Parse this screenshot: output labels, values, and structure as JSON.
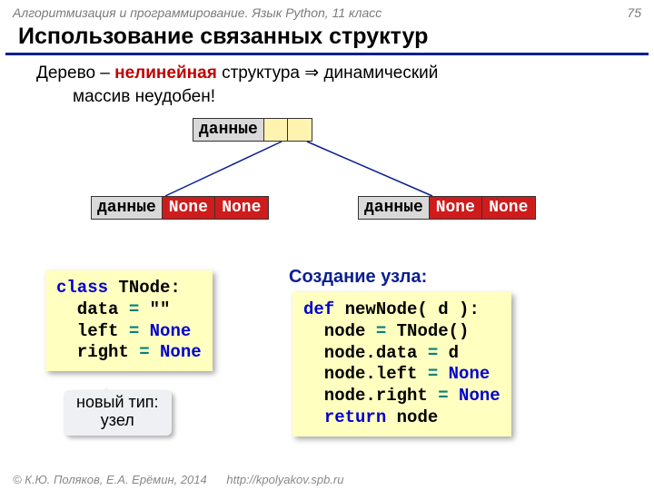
{
  "header": {
    "course": "Алгоритмизация и программирование. Язык Python, 11 класс",
    "page": "75"
  },
  "title": "Использование связанных структур",
  "subtitle": {
    "before": "Дерево – ",
    "nonlinear": "нелинейная",
    "after": " структура ⇒ динамический",
    "line2": "массив неудобен!"
  },
  "node": {
    "data": "данные",
    "none": "None"
  },
  "code_class": {
    "line1_kw": "class",
    "line1_rest": " TNode:",
    "line2a": "  data ",
    "line2op": "=",
    "line2b": " \"\"",
    "line3a": "  left ",
    "line3op": "=",
    "line3b": " ",
    "line3c": "None",
    "line4a": "  right ",
    "line4op": "=",
    "line4b": " ",
    "line4c": "None"
  },
  "section_label": "Создание узла:",
  "code_func": {
    "l1a": "def",
    "l1b": " newNode( d ):",
    "l2a": "  node ",
    "l2op": "=",
    "l2b": " TNode()",
    "l3a": "  node.data ",
    "l3op": "=",
    "l3b": " d",
    "l4a": "  node.left ",
    "l4op": "=",
    "l4b": " ",
    "l4c": "None",
    "l5a": "  node.right ",
    "l5op": "=",
    "l5b": " ",
    "l5c": "None",
    "l6a": "  ",
    "l6b": "return",
    "l6c": " node"
  },
  "callout": {
    "line1": "новый тип:",
    "line2": "узел"
  },
  "footer": {
    "copyright": "© К.Ю. Поляков, Е.А. Ерёмин, 2014",
    "url": "http://kpolyakov.spb.ru"
  }
}
